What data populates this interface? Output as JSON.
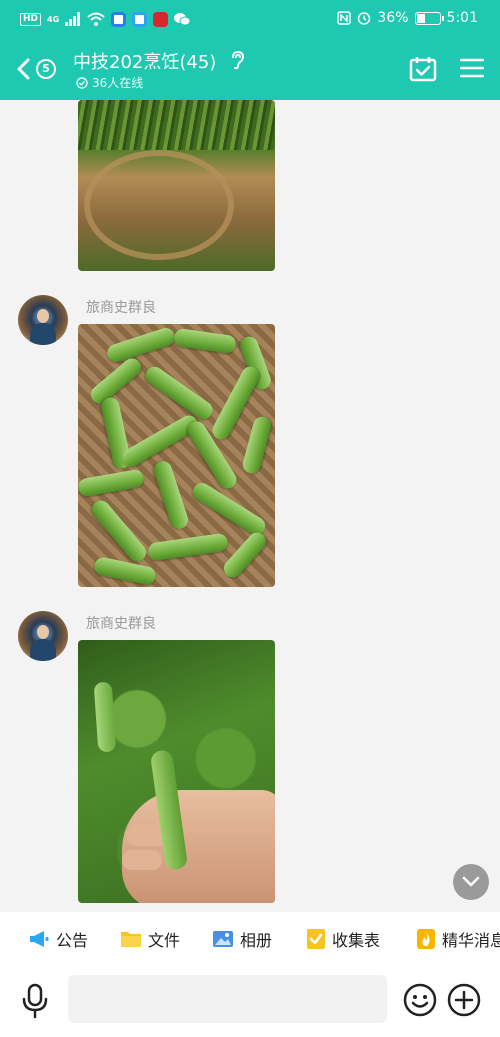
{
  "status_bar": {
    "left_badges": [
      "HD",
      "4G"
    ],
    "battery_percent": "36%",
    "battery_level": 0.36,
    "time": "5:01"
  },
  "header": {
    "unread_count": "5",
    "title": "中技202烹饪(45)",
    "online_text": "36人在线"
  },
  "messages": [
    {
      "type": "image",
      "sender": "",
      "image_desc": "basket-of-pea-shoots"
    },
    {
      "type": "image",
      "sender": "旅商史群良",
      "image_desc": "pea-pods-on-tray"
    },
    {
      "type": "image",
      "sender": "旅商史群良",
      "image_desc": "pea-plant-hand"
    }
  ],
  "feature_bar": {
    "items": [
      {
        "label": "公告",
        "icon": "megaphone-icon",
        "color": "#2aa6f0"
      },
      {
        "label": "文件",
        "icon": "folder-icon",
        "color": "#f7c325"
      },
      {
        "label": "相册",
        "icon": "photo-album-icon",
        "color": "#4a90e2"
      },
      {
        "label": "收集表",
        "icon": "checklist-icon",
        "color": "#f7c325"
      },
      {
        "label": "精华消息",
        "icon": "flame-icon",
        "color": "#f7b500"
      }
    ]
  },
  "input": {
    "placeholder": "",
    "value": ""
  },
  "colors": {
    "accent": "#1fc8b0",
    "chat_bg": "#f3f3f3",
    "sender_name": "#9a9a9a"
  }
}
